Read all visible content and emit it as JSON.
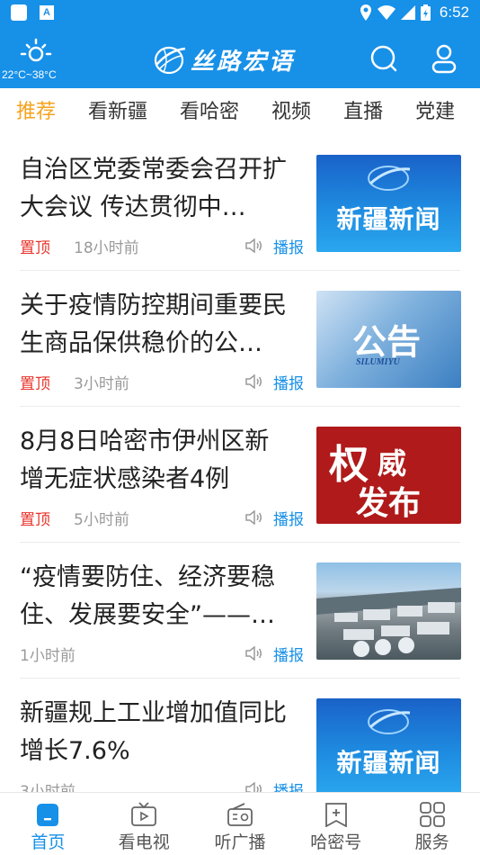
{
  "status_bar": {
    "time": "6:52",
    "a_glyph": "A",
    "icons": [
      "notification-icon",
      "location-icon",
      "wifi-icon",
      "signal-icon",
      "battery-icon"
    ]
  },
  "header": {
    "temperature": "22°C~38°C",
    "logo_text": "丝路宏语",
    "weather_icon": "sun-icon",
    "search_icon": "search-icon",
    "user_icon": "user-icon"
  },
  "tabs": [
    {
      "label": "推荐",
      "active": true
    },
    {
      "label": "看新疆",
      "active": false
    },
    {
      "label": "看哈密",
      "active": false
    },
    {
      "label": "视频",
      "active": false
    },
    {
      "label": "直播",
      "active": false
    },
    {
      "label": "党建",
      "active": false
    }
  ],
  "feed": [
    {
      "title": "自治区党委常委会召开扩大会议 传达贯彻中…",
      "pin": "置顶",
      "time": "18小时前",
      "broadcast": "播报",
      "thumb": {
        "kind": "xj",
        "text": "新疆新闻"
      }
    },
    {
      "title": "关于疫情防控期间重要民生商品保供稳价的公…",
      "pin": "置顶",
      "time": "3小时前",
      "broadcast": "播报",
      "thumb": {
        "kind": "gg",
        "text": "公告",
        "sub": "SILUMIYU"
      }
    },
    {
      "title": "8月8日哈密市伊州区新增无症状感染者4例",
      "pin": "置顶",
      "time": "5小时前",
      "broadcast": "播报",
      "thumb": {
        "kind": "qw",
        "t1": "权",
        "t2": "威",
        "t3": "发布"
      }
    },
    {
      "title": "“疫情要防住、经济要稳住、发展要安全”——习…",
      "pin": "",
      "time": "1小时前",
      "broadcast": "播报",
      "thumb": {
        "kind": "photo"
      }
    },
    {
      "title": "新疆规上工业增加值同比增长7.6%",
      "pin": "",
      "time": "3小时前",
      "broadcast": "播报",
      "thumb": {
        "kind": "xj",
        "text": "新疆新闻"
      }
    }
  ],
  "bottom_nav": [
    {
      "label": "首页",
      "icon": "home-icon",
      "active": true
    },
    {
      "label": "看电视",
      "icon": "tv-icon",
      "active": false
    },
    {
      "label": "听广播",
      "icon": "radio-icon",
      "active": false
    },
    {
      "label": "哈密号",
      "icon": "bookmark-plus-icon",
      "active": false
    },
    {
      "label": "服务",
      "icon": "grid-icon",
      "active": false
    }
  ],
  "colors": {
    "brand_blue": "#1790e8",
    "active_tab": "#f5a21c",
    "pin_red": "#e8332a"
  }
}
